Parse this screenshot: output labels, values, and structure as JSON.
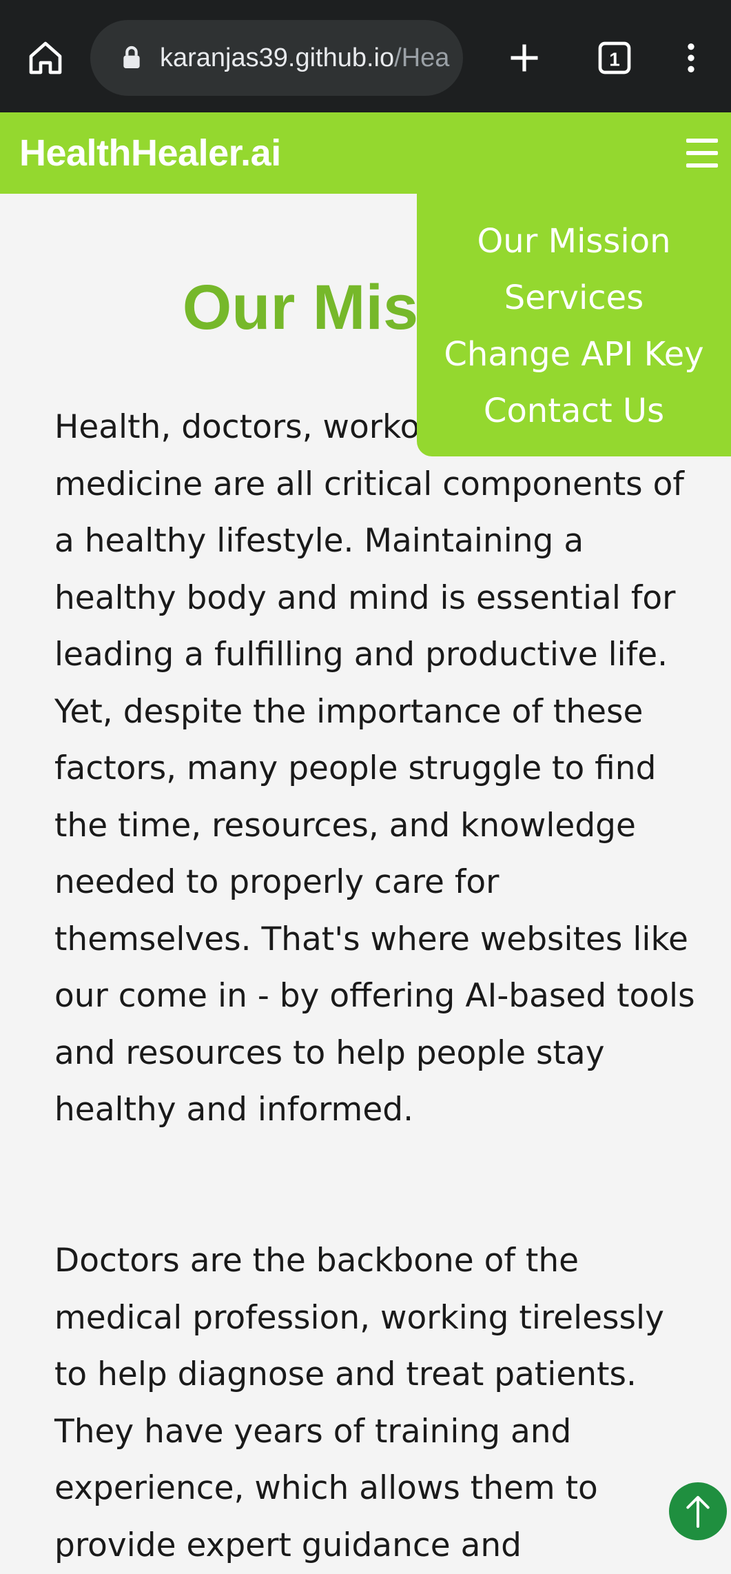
{
  "browser": {
    "url_main": "karanjas39.github.io",
    "url_path": "/Hea",
    "tab_count": "1",
    "icons": [
      "home-icon",
      "lock-icon",
      "plus-icon",
      "tabs-icon",
      "more-vert-icon"
    ]
  },
  "site": {
    "brand": "HealthHealer.ai"
  },
  "menu": {
    "items": [
      {
        "label": "Our Mission"
      },
      {
        "label": "Services"
      },
      {
        "label": "Change API Key"
      },
      {
        "label": "Contact Us"
      }
    ]
  },
  "main": {
    "title": "Our Mission",
    "paragraphs": [
      "Health, doctors, workouts, and medicine are all critical components of a healthy lifestyle. Maintaining a healthy body and mind is essential for leading a fulfilling and productive life. Yet, despite the importance of these factors, many people struggle to find the time, resources, and knowledge needed to properly care for themselves. That's where websites like our come in - by offering AI-based tools and resources to help people stay healthy and informed.",
      "Doctors are the backbone of the medical profession, working tirelessly to help diagnose and treat patients. They have years of training and experience, which allows them to provide expert guidance and"
    ]
  },
  "colors": {
    "accent": "#94d82f",
    "title": "#76b82a",
    "scroll_button": "#1f8f3f",
    "browser_bar": "#1d1f20"
  }
}
